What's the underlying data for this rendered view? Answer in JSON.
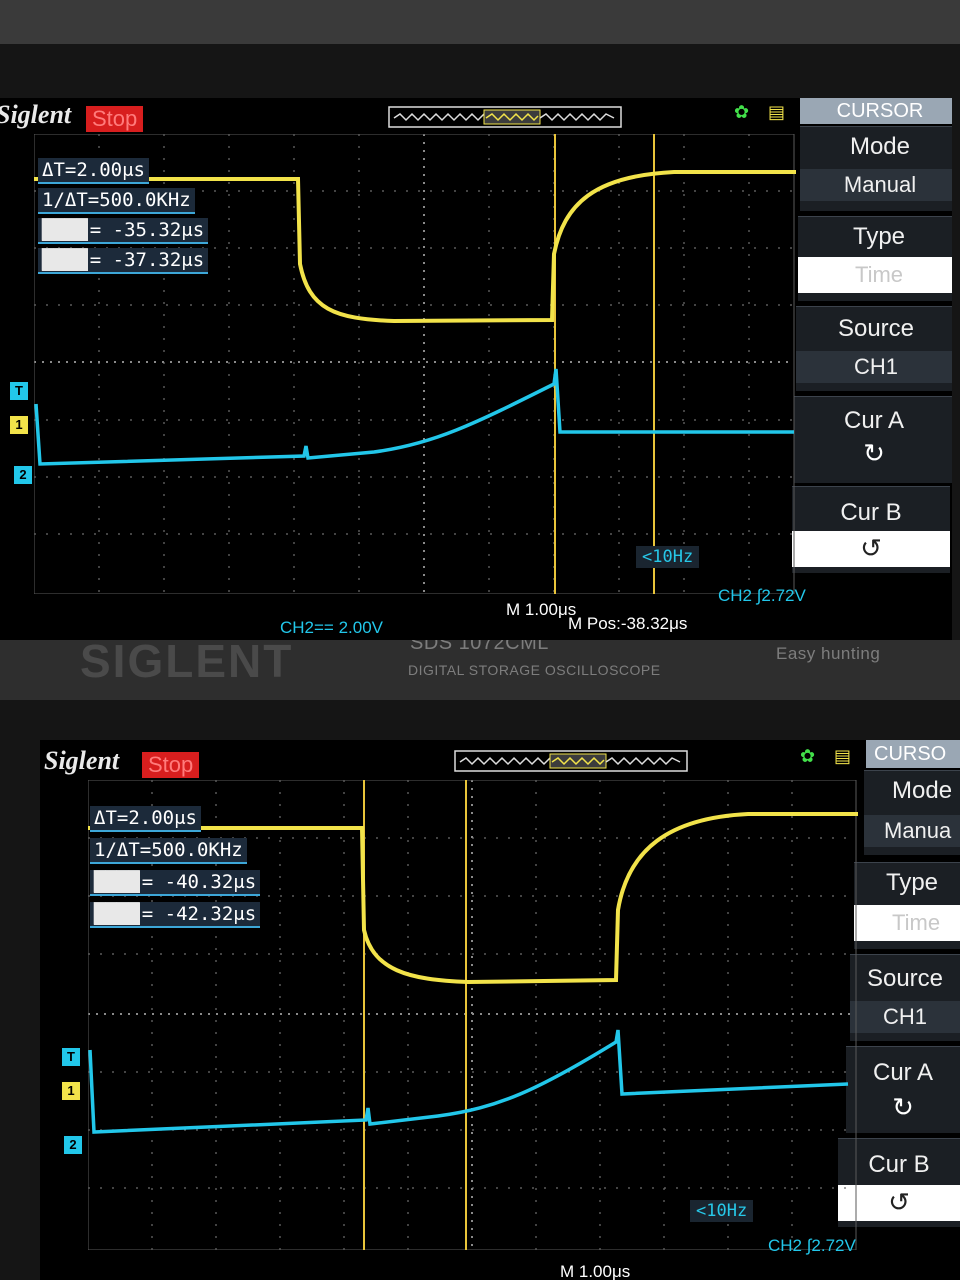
{
  "top_capture": {
    "logo": "Siglent",
    "run_state": "Stop",
    "menu": {
      "title": "CURSOR",
      "items": [
        {
          "label": "Mode",
          "value": "Manual"
        },
        {
          "label": "Type",
          "value": "Time"
        },
        {
          "label": "Source",
          "value": "CH1"
        },
        {
          "label": "Cur A",
          "knob": "↻"
        },
        {
          "label": "Cur B",
          "knob": "↺"
        }
      ]
    },
    "measurements": {
      "delta_t": "ΔT=2.00μs",
      "inv_delta_t": "1/ΔT=500.0KHz",
      "cur_a": "= -35.32μs",
      "cur_b": "= -37.32μs"
    },
    "trigger_freq": "<10Hz",
    "ch2_scale": "CH2== 2.00V",
    "timebase": "M 1.00μs",
    "m_pos": "M Pos:-38.32μs",
    "trigger_level": "CH2 ∫2.72V",
    "channel_markers": [
      "T",
      "1",
      "2"
    ],
    "colors": {
      "ch1": "#f2e34a",
      "ch2": "#22c7ea",
      "cursor": "#e8c43a",
      "grid": "#7a7a7a"
    }
  },
  "bottom_capture": {
    "bezel_model": "SDS 1072CML",
    "bezel_subtitle": "DIGITAL STORAGE OSCILLOSCOPE",
    "bezel_brand": "SIGLENT",
    "bezel_feature": "Easy hunting",
    "logo": "Siglent",
    "run_state": "Stop",
    "menu": {
      "title": "CURSO",
      "items": [
        {
          "label": "Mode",
          "value": "Manua"
        },
        {
          "label": "Type",
          "value": "Time"
        },
        {
          "label": "Source",
          "value": "CH1"
        },
        {
          "label": "Cur A",
          "knob": "↻"
        },
        {
          "label": "Cur B",
          "knob": "↺"
        }
      ]
    },
    "measurements": {
      "delta_t": "ΔT=2.00μs",
      "inv_delta_t": "1/ΔT=500.0KHz",
      "cur_a": "= -40.32μs",
      "cur_b": "= -42.32μs"
    },
    "trigger_freq": "<10Hz",
    "timebase": "M 1.00μs",
    "trigger_level": "CH2 ∫2.72V",
    "channel_markers": [
      "T",
      "1",
      "2"
    ]
  }
}
